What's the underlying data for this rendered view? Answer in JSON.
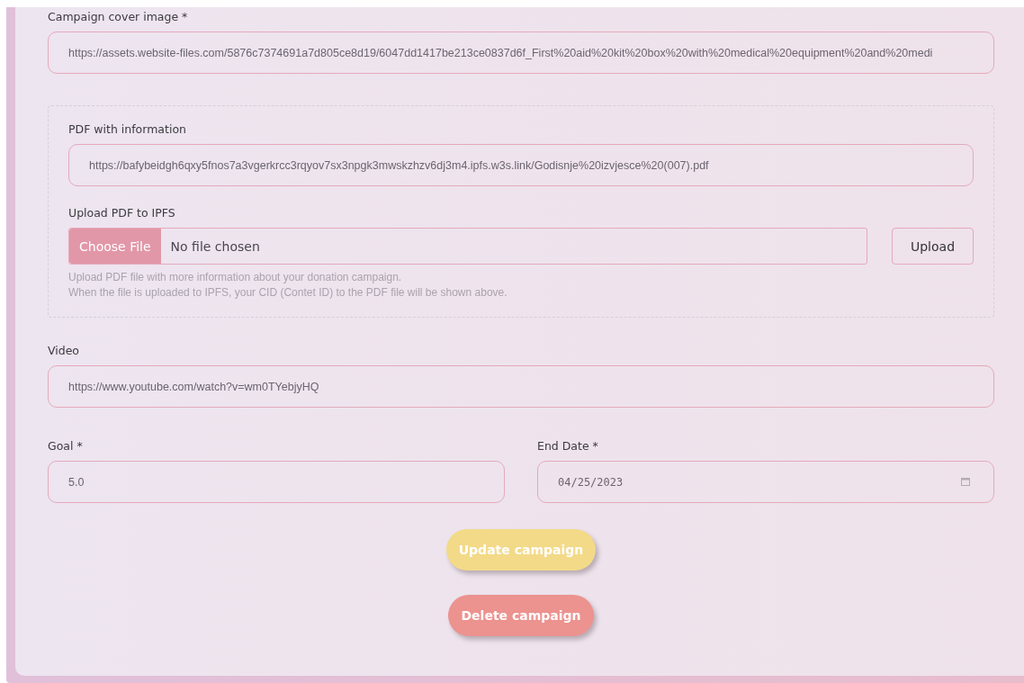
{
  "cover_image": {
    "label": "Campaign cover image *",
    "value": "https://assets.website-files.com/5876c7374691a7d805ce8d19/6047dd1417be213ce0837d6f_First%20aid%20kit%20box%20with%20medical%20equipment%20and%20medi"
  },
  "pdf_section": {
    "pdf_field": {
      "label": "PDF with information",
      "value": "https://bafybeidgh6qxy5fnos7a3vgerkrcc3rqyov7sx3npgk3mwskzhzv6dj3m4.ipfs.w3s.link/Godisnje%20izvjesce%20(007).pdf"
    },
    "upload": {
      "label": "Upload PDF to IPFS",
      "choose_button": "Choose File",
      "status": "No file chosen",
      "upload_button": "Upload",
      "help": [
        "Upload PDF file with more information about your donation campaign.",
        "When the file is uploaded to IPFS, your CID (Contet ID) to the PDF file will be shown above."
      ]
    }
  },
  "video": {
    "label": "Video",
    "value": "https://www.youtube.com/watch?v=wm0TYebjyHQ"
  },
  "goal": {
    "label": "Goal *",
    "value": "5.0"
  },
  "end_date": {
    "label": "End Date *",
    "value": "04/25/2023"
  },
  "buttons": [
    {
      "label": "Update campaign",
      "kind": "update"
    },
    {
      "label": "Delete campaign",
      "kind": "delete"
    }
  ]
}
